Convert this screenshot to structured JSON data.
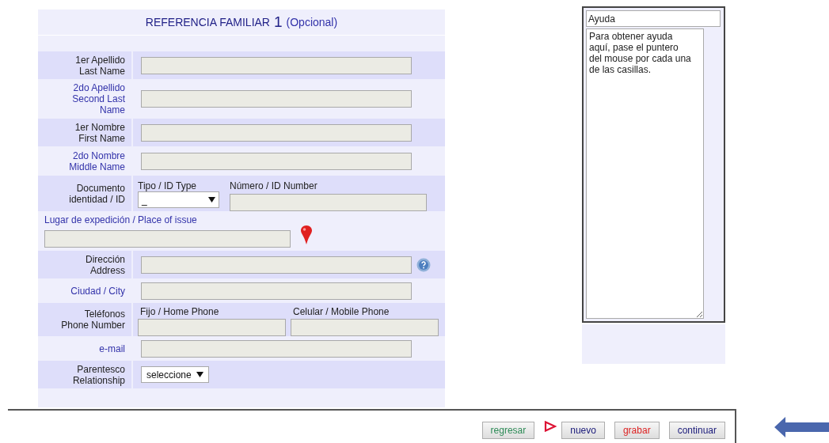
{
  "form": {
    "title": {
      "text": "REFERENCIA FAMILIAR",
      "number": "1",
      "note": "(Opcional)"
    },
    "rows": [
      {
        "kind": "text",
        "label": [
          "1er Apellido",
          "Last Name"
        ],
        "required": true
      },
      {
        "kind": "text",
        "label": [
          "2do Apellido",
          "Second Last",
          "Name"
        ],
        "required": false
      },
      {
        "kind": "text",
        "label": [
          "1er Nombre",
          "First Name"
        ],
        "required": true
      },
      {
        "kind": "text",
        "label": [
          "2do Nombre",
          "Middle Name"
        ],
        "required": false
      },
      {
        "kind": "id_document",
        "label": [
          "Documento",
          "identidad / ID"
        ],
        "required": true,
        "type_label": "Tipo / ID Type",
        "type_value": "_",
        "number_label": "Número / ID Number"
      },
      {
        "kind": "place",
        "label": [
          "Lugar de expedición / Place of issue"
        ],
        "required": false
      },
      {
        "kind": "text",
        "label": [
          "Dirección",
          "Address"
        ],
        "required": true,
        "help": true
      },
      {
        "kind": "text",
        "label": [
          "Ciudad / City"
        ],
        "required": false
      },
      {
        "kind": "phones",
        "label": [
          "Teléfonos",
          "Phone Number"
        ],
        "required": true,
        "home_label": "Fijo / Home Phone",
        "mobile_label": "Celular / Mobile Phone"
      },
      {
        "kind": "text",
        "label": [
          "e-mail"
        ],
        "required": false
      },
      {
        "kind": "select",
        "label": [
          "Parentesco",
          "Relationship"
        ],
        "required": true,
        "value": "seleccione"
      }
    ]
  },
  "help": {
    "title": "Ayuda",
    "text": "Para obtener ayuda aquí, pase el puntero del mouse por cada una de las casillas."
  },
  "buttons": [
    {
      "label": "regresar",
      "color": "#2e8b57",
      "marker": false
    },
    {
      "label": "nuevo",
      "color": "#1a1a7a",
      "marker": true
    },
    {
      "label": "grabar",
      "color": "#dd2222",
      "marker": false
    },
    {
      "label": "continuar",
      "color": "#1a1a7a",
      "marker": false
    }
  ]
}
